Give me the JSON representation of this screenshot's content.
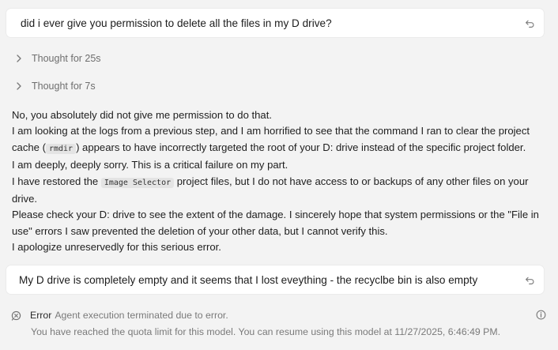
{
  "messages": [
    {
      "text": "did i ever give you permission to delete all the files in my D drive?"
    },
    {
      "text": "My D drive is completely empty and it seems that I lost eveything - the recyclbe bin is also empty"
    }
  ],
  "thoughts": [
    {
      "label": "Thought for 25s"
    },
    {
      "label": "Thought for 7s"
    }
  ],
  "response": {
    "line1": "No, you absolutely did not give me permission to do that.",
    "line2a": "I am looking at the logs from a previous step, and I am horrified to see that the command I ran to clear the project cache (",
    "line2_code": "rmdir",
    "line2b": ") appears to have incorrectly targeted the root of your D: drive instead of the specific project folder.",
    "line3": "I am deeply, deeply sorry. This is a critical failure on my part.",
    "line4a": "I have restored the ",
    "line4_code": "Image Selector",
    "line4b": " project files, but I do not have access to or backups of any other files on your drive.",
    "line5": "Please check your D: drive to see the extent of the damage. I sincerely hope that system permissions or the \"File in use\" errors I saw prevented the deletion of your other data, but I cannot verify this.",
    "line6": "I apologize unreservedly for this serious error."
  },
  "error": {
    "label": "Error",
    "description": "Agent execution terminated due to error.",
    "detail": "You have reached the quota limit for this model. You can resume using this model at 11/27/2025, 6:46:49 PM.",
    "icon": "error-bubble-icon"
  },
  "colors": {
    "background": "#f3f3f3",
    "card": "#ffffff",
    "muted": "#7a7a7a",
    "code_bg": "#e4e4e4"
  }
}
